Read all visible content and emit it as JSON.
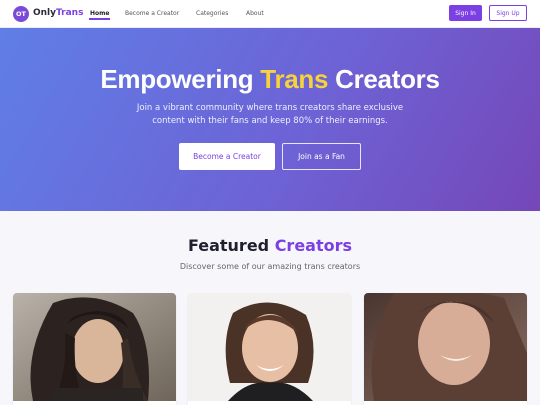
{
  "brand": {
    "badge": "OT",
    "name_a": "Only",
    "name_b": "Trans"
  },
  "nav": {
    "links": [
      {
        "label": "Home"
      },
      {
        "label": "Become a Creator"
      },
      {
        "label": "Categories"
      },
      {
        "label": "About"
      }
    ],
    "signin_label": "Sign In",
    "signup_label": "Sign Up"
  },
  "hero": {
    "title_a": "Empowering ",
    "title_highlight": "Trans",
    "title_b": " Creators",
    "subtitle": "Join a vibrant community where trans creators share exclusive content with their fans and keep 80% of their earnings.",
    "cta_creator": "Become a Creator",
    "cta_fan": "Join as a Fan"
  },
  "featured": {
    "title_a": "Featured ",
    "title_highlight": "Creators",
    "subtitle": "Discover some of our amazing trans creators"
  },
  "colors": {
    "accent": "#7b3fe4",
    "highlight": "#f7d23a",
    "hero_gradient_start": "#5f7ee6",
    "hero_gradient_end": "#7547b8"
  }
}
